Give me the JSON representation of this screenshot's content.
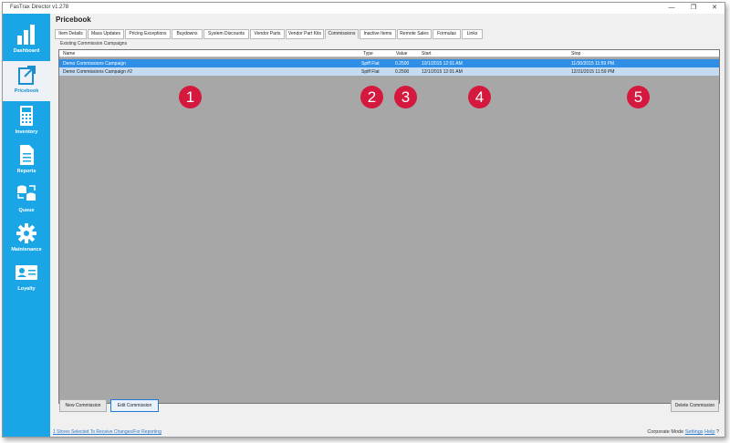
{
  "window": {
    "title": "FasTrax Director v1.278",
    "min": "—",
    "max": "❐",
    "close": "✕"
  },
  "sidebar": {
    "items": [
      {
        "label": "Dashboard",
        "icon": "dashboard-icon"
      },
      {
        "label": "Pricebook",
        "icon": "pricebook-icon",
        "active": true
      },
      {
        "label": "Inventory",
        "icon": "calculator-icon"
      },
      {
        "label": "Reports",
        "icon": "report-icon"
      },
      {
        "label": "Queue",
        "icon": "queue-icon"
      },
      {
        "label": "Maintenance",
        "icon": "gear-icon"
      },
      {
        "label": "Loyalty",
        "icon": "id-card-icon"
      }
    ]
  },
  "page": {
    "title": "Pricebook"
  },
  "tabs": [
    "Item Details",
    "Mass Updates",
    "Pricing Exceptions",
    "Buydowns",
    "System Discounts",
    "Vendor Parts",
    "Vendor Part Kits",
    "Commissions",
    "Inactive Items",
    "Remote Sales",
    "Formulas",
    "Links"
  ],
  "active_tab": "Commissions",
  "section": {
    "label": "Existing Commission Campaigns"
  },
  "table": {
    "columns": [
      "Name",
      "Type",
      "Value",
      "Start",
      "Stop"
    ],
    "rows": [
      [
        "Demo Commissions Campaign",
        "Spiff Flat",
        "0.2500",
        "10/1/2015 12:01 AM",
        "11/30/2015 11:59 PM"
      ],
      [
        "Demo Commissions Campaign #2",
        "Spiff Flat",
        "0.2500",
        "12/1/2015 12:01 AM",
        "12/31/2015 11:59 PM"
      ]
    ]
  },
  "callouts": [
    "1",
    "2",
    "3",
    "4",
    "5"
  ],
  "buttons": {
    "new": "New Commission",
    "edit": "Edit Commission",
    "delete": "Delete Commission"
  },
  "status": {
    "link": "1 Stores Selected To Receive Changes/For Reporting",
    "mode": "Corporate Mode",
    "settings": "Settings",
    "help": "Help",
    "help_icon": "?"
  },
  "colors": {
    "sidebar": "#1aa6e6",
    "selected_row": "#2f8fe6",
    "callout": "#d4183e"
  }
}
